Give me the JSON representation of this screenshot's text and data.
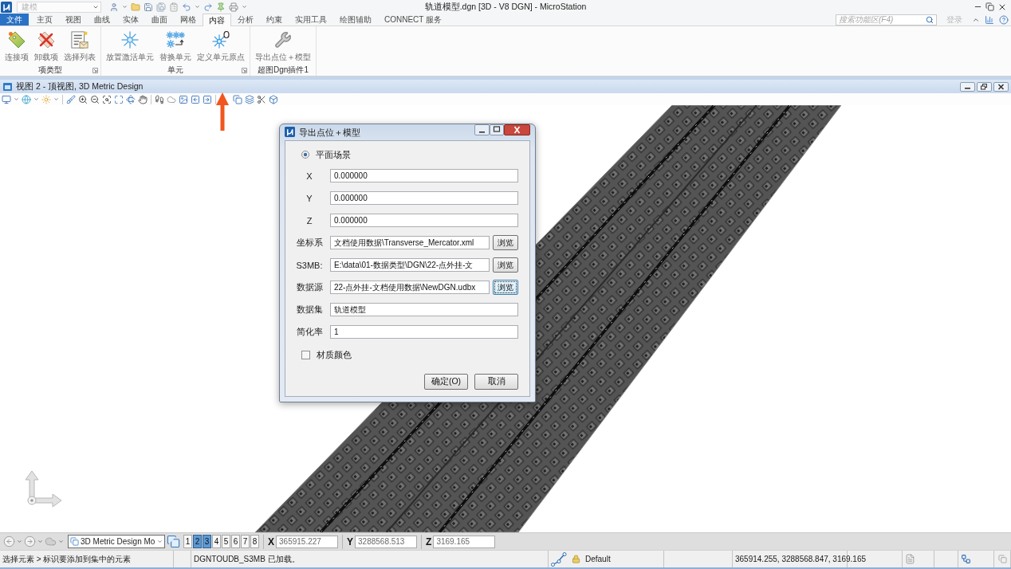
{
  "title_bar": {
    "workflow": "建模",
    "title": "轨道模型.dgn [3D - V8 DGN] - MicroStation"
  },
  "ribbon": {
    "tabs": [
      {
        "label": "文件",
        "kind": "file",
        "selected": false
      },
      {
        "label": "主页",
        "kind": "tab",
        "selected": false
      },
      {
        "label": "视图",
        "kind": "tab",
        "selected": false
      },
      {
        "label": "曲线",
        "kind": "tab",
        "selected": false
      },
      {
        "label": "实体",
        "kind": "tab",
        "selected": false
      },
      {
        "label": "曲面",
        "kind": "tab",
        "selected": false
      },
      {
        "label": "网格",
        "kind": "tab",
        "selected": false
      },
      {
        "label": "内容",
        "kind": "tab",
        "selected": true
      },
      {
        "label": "分析",
        "kind": "tab",
        "selected": false
      },
      {
        "label": "约束",
        "kind": "tab",
        "selected": false
      },
      {
        "label": "实用工具",
        "kind": "tab",
        "selected": false
      },
      {
        "label": "绘图辅助",
        "kind": "tab",
        "selected": false
      },
      {
        "label": "CONNECT 服务",
        "kind": "tab",
        "selected": false
      }
    ],
    "search": {
      "placeholder": "搜索功能区(F4)"
    },
    "sign_in": "登录",
    "groups": [
      {
        "label": "项类型",
        "launcher": true,
        "items": [
          {
            "label": "连接项",
            "kind": "attach"
          },
          {
            "label": "卸载项",
            "kind": "detach"
          },
          {
            "label": "选择列表",
            "kind": "list"
          }
        ]
      },
      {
        "label": "单元",
        "launcher": true,
        "items": [
          {
            "label": "放置激活单元",
            "kind": "place_cell"
          },
          {
            "label": "替换单元",
            "kind": "replace_cell"
          },
          {
            "label": "定义单元原点",
            "kind": "cell_origin"
          }
        ]
      },
      {
        "label": "超图Dgn插件1",
        "launcher": false,
        "items": [
          {
            "label": "导出点位＋模型",
            "kind": "export"
          }
        ]
      }
    ]
  },
  "view": {
    "title": "视图 2 - 顶视图, 3D Metric Design"
  },
  "dialog": {
    "title": "导出点位＋模型",
    "scene": {
      "label": "平面场景",
      "selected": true
    },
    "fields": [
      {
        "label": "X",
        "value": "0.000000"
      },
      {
        "label": "Y",
        "value": "0.000000"
      },
      {
        "label": "Z",
        "value": "0.000000"
      },
      {
        "label": "坐标系",
        "value": "文档使用数据\\Transverse_Mercator.xml",
        "browse": {
          "label": "浏览",
          "focused": false
        }
      },
      {
        "label": "S3MB:",
        "value": "E:\\data\\01-数据类型\\DGN\\22-点外挂-文",
        "browse": {
          "label": "浏览",
          "focused": false
        }
      },
      {
        "label": "数据源",
        "value": "22-点外挂-文档使用数据\\NewDGN.udbx",
        "browse": {
          "label": "浏览",
          "focused": true
        }
      },
      {
        "label": "数据集",
        "value": "轨道模型"
      },
      {
        "label": "简化率",
        "value": "1"
      }
    ],
    "material": {
      "label": "材质颜色",
      "checked": false
    },
    "buttons": [
      "确定(O)",
      "取消"
    ]
  },
  "bottom_toolbar": {
    "model": "3D Metric Design Mo",
    "views": [
      {
        "label": "1",
        "selected": false
      },
      {
        "label": "2",
        "selected": true
      },
      {
        "label": "3",
        "selected": true
      },
      {
        "label": "4",
        "selected": false
      },
      {
        "label": "5",
        "selected": false
      },
      {
        "label": "6",
        "selected": false
      },
      {
        "label": "7",
        "selected": false
      },
      {
        "label": "8",
        "selected": false
      }
    ],
    "coordinates": [
      {
        "label": "X",
        "value": "365915.227"
      },
      {
        "label": "Y",
        "value": "3288568.513"
      },
      {
        "label": "Z",
        "value": "3169.165"
      }
    ]
  },
  "status_bar": {
    "prompt": "选择元素 > 标识要添加到集中的元素",
    "message": "DGNTOUDB_S3MB 已加载。",
    "active_level": "Default",
    "position": "365914.255, 3288568.847, 3169.165"
  }
}
